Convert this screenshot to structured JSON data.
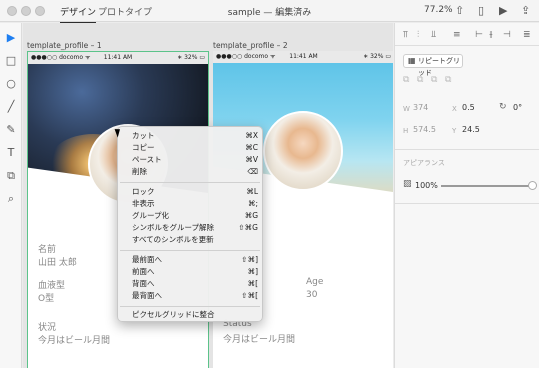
{
  "window": {
    "tabs": [
      "デザイン",
      "プロトタイプ"
    ],
    "title": "sample — 編集済み",
    "zoom": "77.2%"
  },
  "icons": {
    "select": "▶",
    "rect": "□",
    "ellipse": "○",
    "line": "╱",
    "pen": "✎",
    "text": "T",
    "artboard": "⧉",
    "zoom": "⌕",
    "share": "⇧",
    "device": "▯",
    "play": "▶",
    "upload": "⇪"
  },
  "artboards": [
    {
      "label": "template_profile – 1",
      "status_left": "●●●○○ docomo ᯤ",
      "status_time": "11:41 AM",
      "status_right": "∗ 32% ▭",
      "fields": [
        {
          "label": "名前",
          "value": "山田 太郎"
        },
        {
          "label": "血液型",
          "value": "O型"
        },
        {
          "label": "状況",
          "value": "今月はビール月間"
        }
      ]
    },
    {
      "label": "template_profile – 2",
      "status_left": "●●●○○ docomo ᯤ",
      "status_time": "11:41 AM",
      "status_right": "∗ 32% ▭",
      "fields": [
        {
          "label": "Age",
          "value": "30"
        },
        {
          "label": "Status",
          "value": "今月はビール月間"
        }
      ]
    }
  ],
  "context_menu": {
    "groups": [
      [
        {
          "label": "カット",
          "shortcut": "⌘X"
        },
        {
          "label": "コピー",
          "shortcut": "⌘C"
        },
        {
          "label": "ペースト",
          "shortcut": "⌘V"
        },
        {
          "label": "削除",
          "shortcut": "⌫"
        }
      ],
      [
        {
          "label": "ロック",
          "shortcut": "⌘L"
        },
        {
          "label": "非表示",
          "shortcut": "⌘;"
        },
        {
          "label": "グループ化",
          "shortcut": "⌘G"
        },
        {
          "label": "シンボルをグループ解除",
          "shortcut": "⇧⌘G"
        },
        {
          "label": "すべてのシンボルを更新",
          "shortcut": ""
        }
      ],
      [
        {
          "label": "最前面へ",
          "shortcut": "⇧⌘]"
        },
        {
          "label": "前面へ",
          "shortcut": "⌘]"
        },
        {
          "label": "背面へ",
          "shortcut": "⌘["
        },
        {
          "label": "最背面へ",
          "shortcut": "⇧⌘["
        }
      ],
      [
        {
          "label": "ピクセルグリッドに整合",
          "shortcut": ""
        }
      ]
    ]
  },
  "panel": {
    "repeat_grid": "リピートグリッド",
    "w_label": "W",
    "w_value": "374",
    "x_label": "X",
    "x_value": "0.5",
    "rotation": "0°",
    "h_label": "H",
    "h_value": "574.5",
    "y_label": "Y",
    "y_value": "24.5",
    "appearance": "アピアランス",
    "opacity": "100%"
  }
}
